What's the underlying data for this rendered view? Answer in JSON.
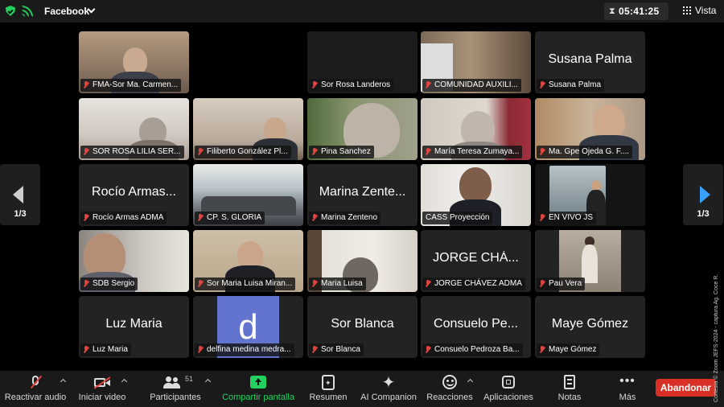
{
  "topbar": {
    "app_label": "Facebook",
    "timer": "05:41:25",
    "view_label": "Vista"
  },
  "pager": {
    "left_text": "1/3",
    "right_text": "1/3"
  },
  "tiles": [
    {
      "name": "FMA-Sor Ma. Carmen...",
      "big": "",
      "muted": true
    },
    {
      "name": "Sor Rosa Landeros",
      "big": "",
      "muted": true
    },
    {
      "name": "COMUNIDAD AUXILI...",
      "big": "",
      "muted": true
    },
    {
      "name": "Susana Palma",
      "big": "Susana Palma",
      "muted": true
    },
    {
      "name": "SOR ROSA LILIA SER...",
      "big": "",
      "muted": true
    },
    {
      "name": "Filiberto González Pl...",
      "big": "",
      "muted": true
    },
    {
      "name": "Pina Sanchez",
      "big": "",
      "muted": true
    },
    {
      "name": "María Teresa Zumaya...",
      "big": "",
      "muted": true
    },
    {
      "name": "Ma. Gpe Ojeda G. F....",
      "big": "",
      "muted": true
    },
    {
      "name": "Rocío Armas ADMA",
      "big": "Rocío Armas...",
      "muted": true
    },
    {
      "name": "CP. S. GLORIA",
      "big": "",
      "muted": true
    },
    {
      "name": "Marina Zenteno",
      "big": "Marina Zente...",
      "muted": true
    },
    {
      "name": "CASS Proyección",
      "big": "",
      "muted": false
    },
    {
      "name": "EN VIVO JS",
      "big": "",
      "muted": true
    },
    {
      "name": "SDB Sergio",
      "big": "",
      "muted": true
    },
    {
      "name": "Sor Maria Luisa Miran...",
      "big": "",
      "muted": true
    },
    {
      "name": "Maria Luisa",
      "big": "",
      "muted": true
    },
    {
      "name": "JORGE CHÁVEZ ADMA",
      "big": "JORGE CHÁ...",
      "muted": true
    },
    {
      "name": "Pau Vera",
      "big": "",
      "muted": true
    },
    {
      "name": "Luz Maria",
      "big": "Luz Maria",
      "muted": true
    },
    {
      "name": "delfina medina medra...",
      "big": "",
      "muted": true,
      "avatar_letter": "d"
    },
    {
      "name": "Sor Blanca",
      "big": "Sor Blanca",
      "muted": true
    },
    {
      "name": "Consuelo Pedroza Ba...",
      "big": "Consuelo Pe...",
      "muted": true
    },
    {
      "name": "Maye Gómez",
      "big": "Maye Gómez",
      "muted": true
    }
  ],
  "toolbar": {
    "audio": "Reactivar audio",
    "video": "Iniciar video",
    "participants": "Participantes",
    "participants_count": "51",
    "share": "Compartir pantalla",
    "summary": "Resumen",
    "companion": "AI Companion",
    "reactions": "Reacciones",
    "apps": "Aplicaciones",
    "notes": "Notas",
    "more": "Más",
    "leave": "Abandonar"
  },
  "credit": "Cortesía © Zoom JEFS-2024 - captura Ag. Coce R.",
  "colors": {
    "speaking_outline": "#2ec24c",
    "muted_icon": "#e0443e",
    "leave_button": "#d93025",
    "share_green": "#23d160",
    "avatar_bg": "#6374cf",
    "pager_arrow_right": "#3aa0ff"
  }
}
